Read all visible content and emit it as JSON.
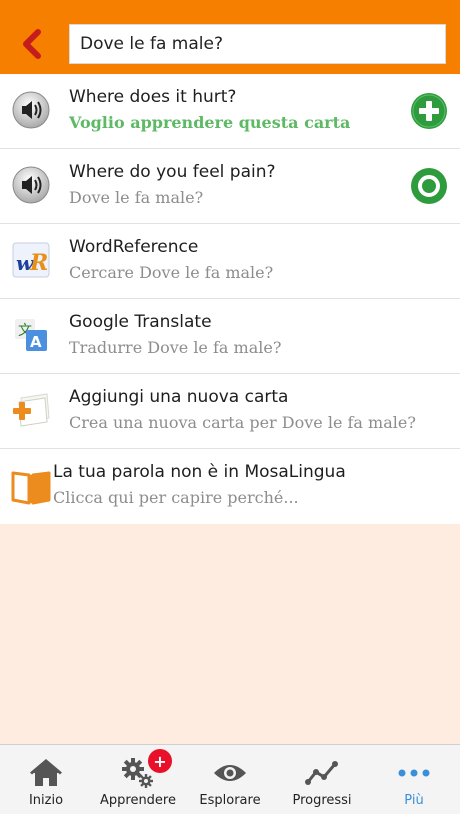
{
  "header": {
    "back_icon": "chevron-left-icon",
    "search_value": "Dove le fa male?",
    "accent": "#f77f00"
  },
  "results": [
    {
      "title": "Where does it hurt?",
      "subtitle": "Voglio apprendere questa carta",
      "left_icon": "speaker-icon",
      "right_icon": "add-circle-icon"
    },
    {
      "title": "Where do you feel pain?",
      "subtitle": "Dove le fa male?",
      "left_icon": "speaker-icon",
      "right_icon": "target-circle-icon"
    },
    {
      "title": "WordReference",
      "subtitle": "Cercare Dove le fa male?",
      "left_icon": "wordreference-logo-icon"
    },
    {
      "title": "Google Translate",
      "subtitle": "Tradurre Dove le fa male?",
      "left_icon": "google-translate-icon"
    },
    {
      "title": "Aggiungi una nuova carta",
      "subtitle": "Crea una nuova carta per Dove le fa male?",
      "left_icon": "add-card-icon"
    },
    {
      "title": "La tua parola non è in MosaLingua",
      "subtitle": "Clicca qui per capire perché...",
      "left_icon": "book-icon"
    }
  ],
  "tabs": [
    {
      "label": "Inizio",
      "icon": "home-icon"
    },
    {
      "label": "Apprendere",
      "icon": "gears-icon",
      "badge": "+"
    },
    {
      "label": "Esplorare",
      "icon": "eye-icon"
    },
    {
      "label": "Progressi",
      "icon": "chart-line-icon"
    },
    {
      "label": "Più",
      "icon": "more-dots-icon",
      "active": true
    }
  ],
  "colors": {
    "green": "#2e9c3d",
    "subtitle_green": "#5db964",
    "active_tab": "#3a8fd9",
    "badge": "#e8102a",
    "background": "#fdecdf"
  }
}
